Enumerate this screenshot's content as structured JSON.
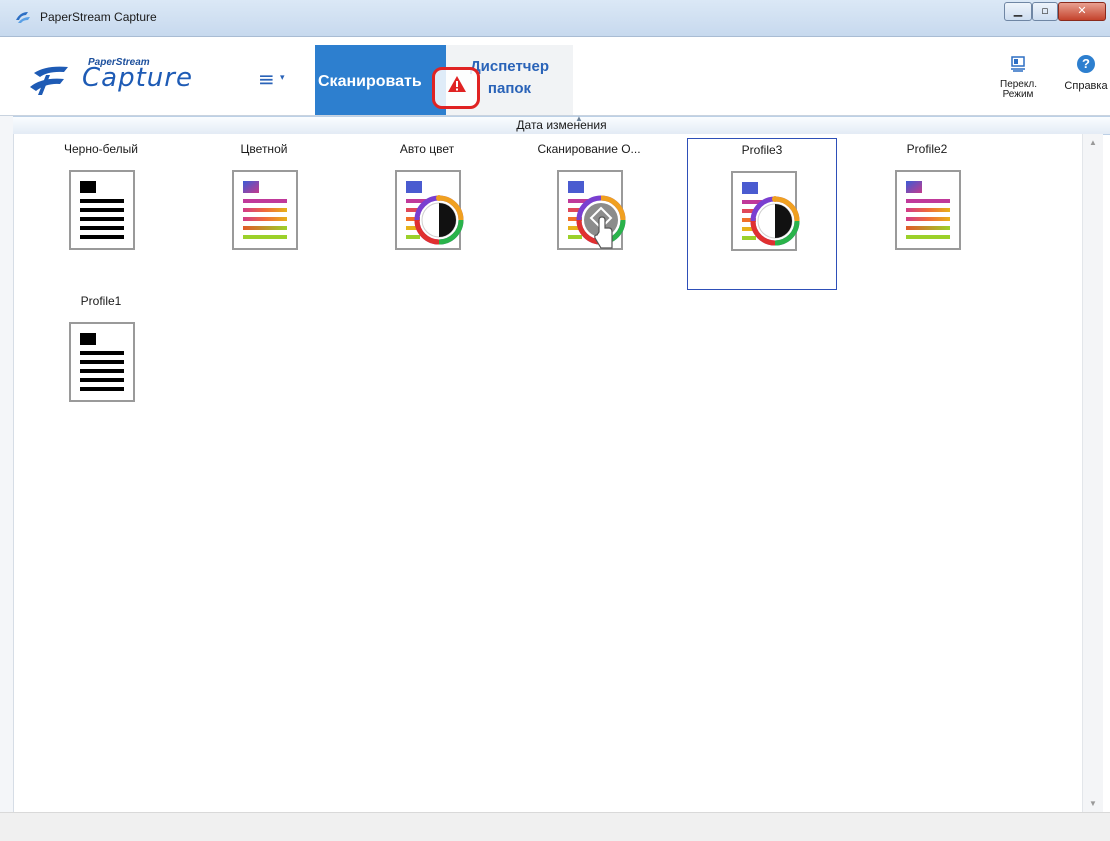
{
  "window": {
    "title": "PaperStream Capture",
    "controls": [
      "minimize",
      "maximize",
      "close"
    ]
  },
  "toolbar": {
    "logo_small": "PaperStream",
    "logo_big": "Capture",
    "menu_icon": "≡",
    "tabs": [
      {
        "label": "Сканировать",
        "active": true
      },
      {
        "label_line1": "Диспетчер",
        "label_line2": "папок",
        "active": false
      }
    ],
    "warning_icon": "warning-icon",
    "switch_mode_label_1": "Перекл.",
    "switch_mode_label_2": "Режим",
    "help_label": "Справка"
  },
  "sort": {
    "label": "Дата изменения"
  },
  "profiles": [
    {
      "name": "Черно-белый",
      "icon": "bw-document-icon",
      "selected": false
    },
    {
      "name": "Цветной",
      "icon": "color-document-icon",
      "selected": false
    },
    {
      "name": "Авто цвет",
      "icon": "auto-color-document-icon",
      "selected": false
    },
    {
      "name": "Сканирование О...",
      "icon": "scan-touch-document-icon",
      "selected": false
    },
    {
      "name": "Profile3",
      "icon": "auto-color-document-icon",
      "selected": true
    },
    {
      "name": "Profile2",
      "icon": "color-document-icon",
      "selected": false
    },
    {
      "name": "Profile1",
      "icon": "bw-document-icon",
      "selected": false
    }
  ],
  "colors": {
    "accent": "#2d7fcf",
    "selection_border": "#2e4fb8",
    "warning": "#e02323"
  }
}
